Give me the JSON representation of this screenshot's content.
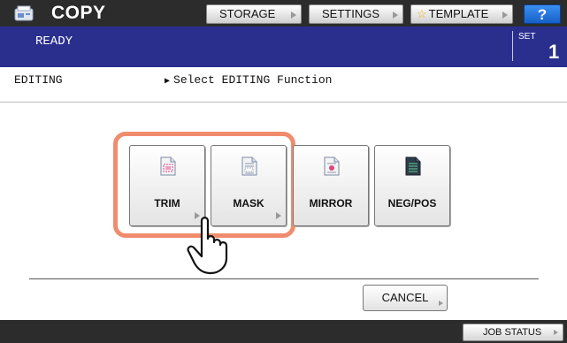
{
  "header": {
    "app_title": "COPY",
    "app_icon": "copier-icon",
    "storage_label": "STORAGE",
    "settings_label": "SETTINGS",
    "template_label": "TEMPLATE",
    "template_icon": "star-icon",
    "help_label": "?"
  },
  "status": {
    "state": "READY",
    "set_label": "SET",
    "set_count": "1"
  },
  "editing": {
    "section_label": "EDITING",
    "instruction": "Select EDITING Function"
  },
  "functions": [
    {
      "label": "TRIM",
      "icon": "trim-document-icon",
      "has_submenu": true
    },
    {
      "label": "MASK",
      "icon": "mask-document-icon",
      "has_submenu": true
    },
    {
      "label": "MIRROR",
      "icon": "mirror-document-icon",
      "has_submenu": false
    },
    {
      "label": "NEG/POS",
      "icon": "negpos-document-icon",
      "has_submenu": false
    }
  ],
  "cancel_label": "CANCEL",
  "job_status_label": "JOB STATUS",
  "colors": {
    "top_bar": "#2c2c2c",
    "status_bar": "#2a2f8e",
    "highlight": "#f08c6c",
    "help_button": "#1d6fd8"
  }
}
